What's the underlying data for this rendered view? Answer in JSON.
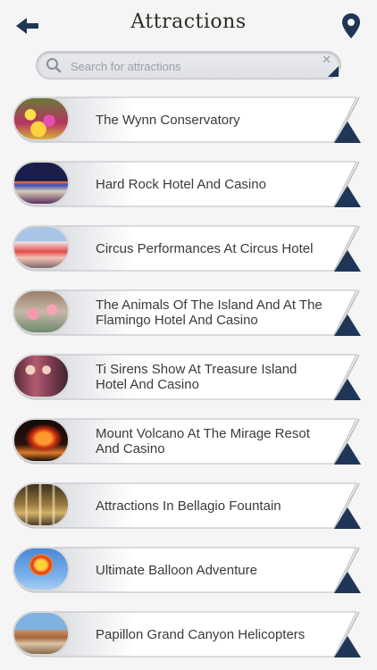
{
  "header": {
    "title": "Attractions",
    "back_icon": "arrow-left-icon",
    "map_icon": "map-pin-icon"
  },
  "search": {
    "placeholder": "Search for attractions",
    "value": ""
  },
  "colors": {
    "background": "#f5f5f5",
    "accent_navy": "#1f3656",
    "text": "#3a3a3a"
  },
  "items": [
    {
      "label": "The Wynn Conservatory"
    },
    {
      "label": "Hard Rock Hotel And Casino"
    },
    {
      "label": "Circus Performances At Circus Hotel"
    },
    {
      "label": "The Animals Of The Island And At The Flamingo Hotel And Casino"
    },
    {
      "label": "Ti Sirens Show At Treasure Island Hotel And Casino"
    },
    {
      "label": "Mount Volcano At The Mirage Resot And Casino"
    },
    {
      "label": "Attractions In Bellagio Fountain"
    },
    {
      "label": "Ultimate Balloon Adventure"
    },
    {
      "label": "Papillon Grand Canyon Helicopters"
    }
  ]
}
